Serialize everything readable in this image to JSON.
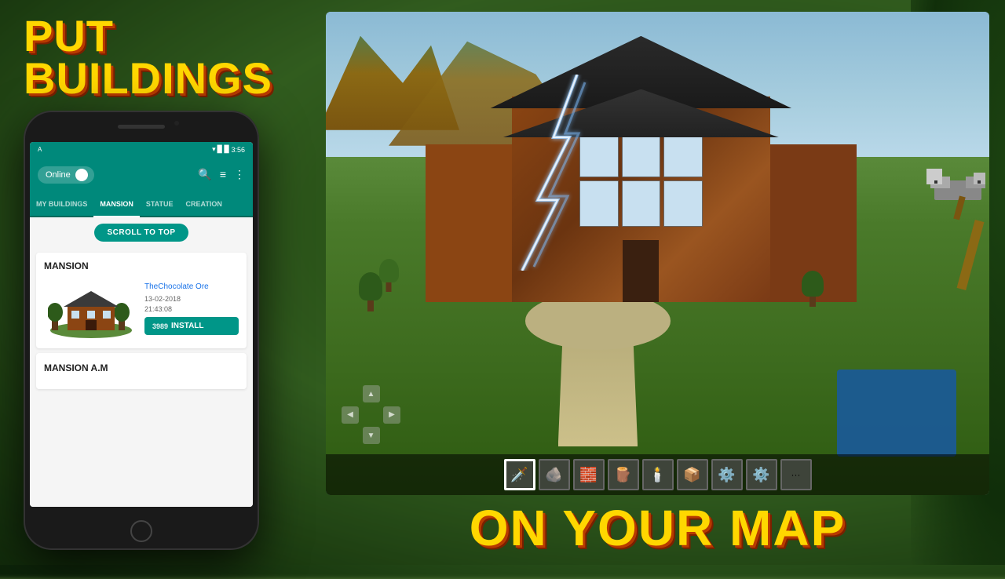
{
  "background": {
    "description": "blurred forest/nature background"
  },
  "hero_text": {
    "line1": "PUT BUILDINGS",
    "line2": "ON YOUR MAP"
  },
  "phone": {
    "status_bar": {
      "time": "3:56",
      "signal": "▼",
      "battery": "▉"
    },
    "app_bar": {
      "online_label": "Online",
      "search_icon": "🔍",
      "filter_icon": "☰",
      "more_icon": "⋮"
    },
    "tabs": [
      {
        "label": "MY BUILDINGS",
        "active": false
      },
      {
        "label": "MANSION",
        "active": true
      },
      {
        "label": "STATUE",
        "active": false
      },
      {
        "label": "CREATION",
        "active": false
      }
    ],
    "scroll_btn_label": "SCROLL TO TOP",
    "buildings": [
      {
        "title": "MANSION",
        "author": "TheChocolate Ore",
        "date": "13-02-2018",
        "time": "21:43:08",
        "installs": "3989",
        "install_label": "INSTALL"
      },
      {
        "title": "MANSION A.M"
      }
    ]
  },
  "minecraft": {
    "hotbar_slots": [
      "🗡️",
      "🪨",
      "🧱",
      "🪵",
      "🕯️",
      "📦",
      "⚙️",
      "⚙️",
      "···"
    ],
    "dpad": {
      "up": "▲",
      "down": "▼",
      "left": "◀",
      "right": "▶"
    }
  },
  "colors": {
    "teal": "#00897B",
    "teal_dark": "#00695C",
    "gold": "#FFD700",
    "orange_shadow": "#c44a00",
    "dark_shadow": "#8B2500",
    "install_green": "#009688",
    "author_blue": "#1a73e8"
  }
}
